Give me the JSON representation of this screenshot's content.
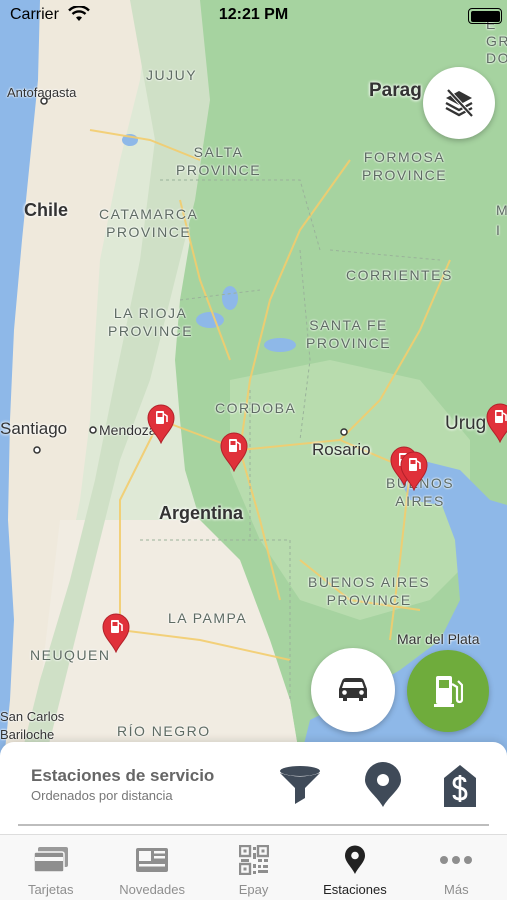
{
  "status_bar": {
    "carrier": "Carrier",
    "time": "12:21 PM"
  },
  "map": {
    "labels": {
      "jujuy": "JUJUY",
      "antofagasta": "Antofagasta",
      "paraguay": "Parag",
      "salta": "SALTA\nPROVINCE",
      "formosa": "FORMOSA\nPROVINCE",
      "chile": "Chile",
      "catamarca": "CATAMARCA\nPROVINCE",
      "corrientes": "CORRIENTES",
      "la_rioja": "LA RIOJA\nPROVINCE",
      "santa_fe": "SANTA FE\nPROVINCE",
      "cordoba": "CORDOBA",
      "santiago": "Santiago",
      "mendoza": "Mendoza",
      "rosario": "Rosario",
      "uruguay": "Urug",
      "buenos_aires_city": "BUENOS\nAIRES",
      "argentina": "Argentina",
      "buenos_aires_prov": "BUENOS AIRES\nPROVINCE",
      "la_pampa": "LA PAMPA",
      "neuquen": "NEUQUEN",
      "mar_del_plata": "Mar del Plata",
      "san_carlos": "San Carlos\nBariloche",
      "rio_negro": "RÍO NEGRO",
      "top_right": "E\nGR\nDO",
      "right_edge": "M\nI"
    }
  },
  "sheet": {
    "title": "Estaciones de servicio",
    "subtitle": "Ordenados por distancia"
  },
  "tabs": [
    {
      "label": "Tarjetas",
      "icon": "cards-icon"
    },
    {
      "label": "Novedades",
      "icon": "news-icon"
    },
    {
      "label": "Epay",
      "icon": "qr-code-icon"
    },
    {
      "label": "Estaciones",
      "icon": "location-pin-icon"
    },
    {
      "label": "Más",
      "icon": "more-dots-icon"
    }
  ],
  "colors": {
    "pin": "#e0313a",
    "fuel_button": "#6fac3c",
    "icon_gray": "#3f4a58",
    "active_tab": "#222222"
  }
}
